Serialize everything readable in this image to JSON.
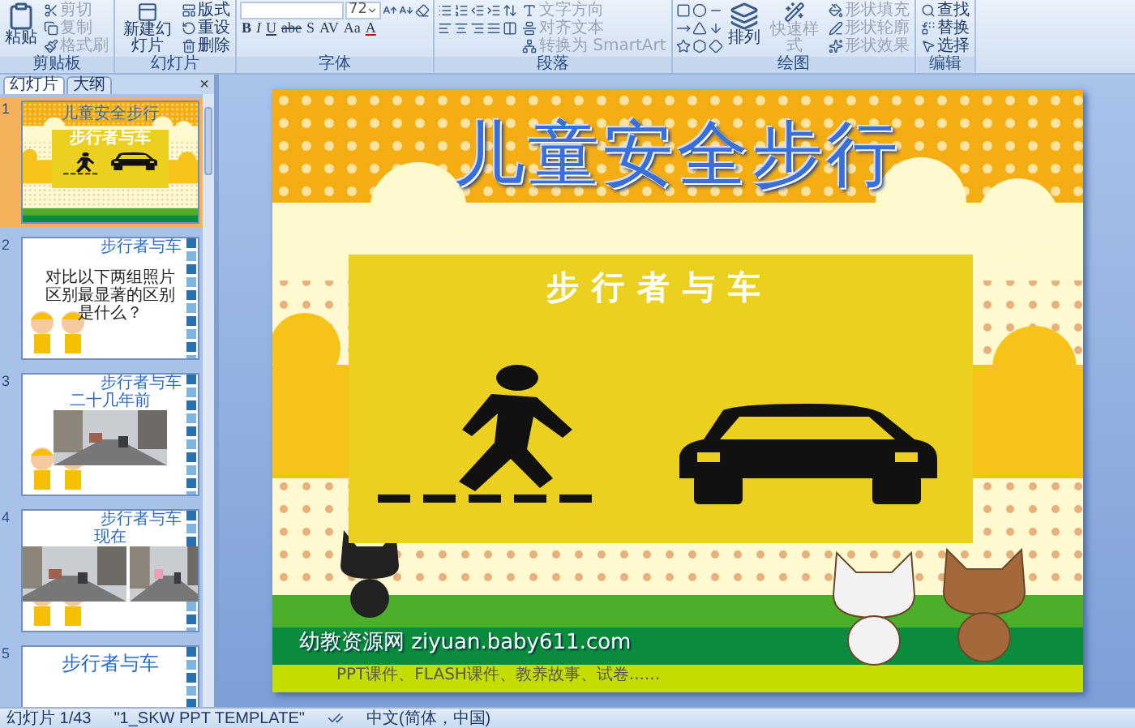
{
  "ribbon": [
    {
      "kind": "clipboard",
      "label": "剪贴板",
      "large": [
        {
          "label": "粘贴",
          "disabled": false
        }
      ],
      "items": [
        {
          "label": "剪切",
          "disabled": true
        },
        {
          "label": "复制",
          "disabled": true
        },
        {
          "label": "格式刷",
          "disabled": true
        }
      ]
    },
    {
      "kind": "slides",
      "label": "幻灯片",
      "large": [
        {
          "label": "新建幻灯片",
          "disabled": false
        }
      ],
      "items": [
        {
          "label": "版式",
          "disabled": false
        },
        {
          "label": "重设",
          "disabled": false
        },
        {
          "label": "删除",
          "disabled": false
        }
      ]
    },
    {
      "kind": "font",
      "label": "字体",
      "font_size": "72",
      "format_buttons": [
        "B",
        "I",
        "U",
        "abe",
        "S",
        "AV",
        "Aa",
        "A"
      ]
    },
    {
      "kind": "paragraph",
      "label": "段落",
      "items": [
        {
          "label": "文字方向",
          "disabled": true
        },
        {
          "label": "对齐文本",
          "disabled": true
        },
        {
          "label": "转换为 SmartArt",
          "disabled": true
        }
      ]
    },
    {
      "kind": "drawing",
      "label": "绘图",
      "large": [
        {
          "label": "排列",
          "disabled": false
        },
        {
          "label": "快速样式",
          "disabled": true
        }
      ],
      "items": [
        {
          "label": "形状填充",
          "disabled": true
        },
        {
          "label": "形状轮廓",
          "disabled": true
        },
        {
          "label": "形状效果",
          "disabled": true
        }
      ]
    },
    {
      "kind": "editing",
      "label": "编辑",
      "items": [
        {
          "label": "查找",
          "disabled": false
        },
        {
          "label": "替换",
          "disabled": false
        },
        {
          "label": "选择",
          "disabled": false
        }
      ]
    }
  ],
  "panel": {
    "tabs": [
      {
        "label": "幻灯片",
        "selected": true
      },
      {
        "label": "大纲",
        "selected": false
      }
    ],
    "close": "×"
  },
  "slides": [
    {
      "number": "1",
      "selected": true,
      "kind": "title",
      "title": "儿童安全步行",
      "subtitle": "步行者与车"
    },
    {
      "number": "2",
      "selected": false,
      "kind": "question",
      "header": "步行者与车",
      "text": "对比以下两组照片区别最显著的区别是什么？"
    },
    {
      "number": "3",
      "selected": false,
      "header": "步行者与车",
      "title": "二十几年前"
    },
    {
      "number": "4",
      "selected": false,
      "kind": "two_photos",
      "header": "步行者与车",
      "title": "现在"
    },
    {
      "number": "5",
      "selected": false,
      "kind": "heading",
      "title": "步行者与车"
    }
  ],
  "slide": {
    "title": "儿童安全步行",
    "sign_title": "步行者与车",
    "site": "幼教资源网 ziyuan.baby611.com",
    "tagline": "PPT课件、FLASH课件、教养故事、试卷......"
  },
  "status_bar": {
    "slide": "幻灯片 1/43",
    "theme": "\"1_SKW PPT TEMPLATE\"",
    "language": "中文(简体，中国)"
  }
}
